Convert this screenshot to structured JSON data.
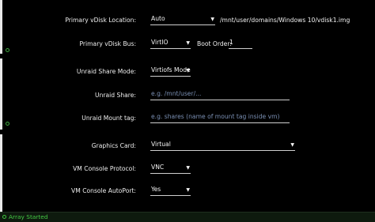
{
  "vdisk": {
    "location_label": "Primary vDisk Location:",
    "location_value": "Auto",
    "location_path": "/mnt/user/domains/Windows 10/vdisk1.img",
    "bus_label": "Primary vDisk Bus:",
    "bus_value": "VirtIO",
    "boot_order_label": "Boot Order:",
    "boot_order_value": "1"
  },
  "share": {
    "mode_label": "Unraid Share Mode:",
    "mode_value": "Virtiofs Mode",
    "share_label": "Unraid Share:",
    "share_placeholder": "e.g. /mnt/user/...",
    "mount_tag_label": "Unraid Mount tag:",
    "mount_tag_placeholder": "e.g. shares (name of mount tag inside vm)"
  },
  "graphics": {
    "card_label": "Graphics Card:",
    "card_value": "Virtual",
    "console_protocol_label": "VM Console Protocol:",
    "console_protocol_value": "VNC",
    "console_autoport_label": "VM Console AutoPort:",
    "console_autoport_value": "Yes"
  },
  "status": {
    "text": "Array Started",
    "color": "#44c944"
  },
  "icons": {
    "section_toggle": "circle-plus-icon",
    "array_status": "status-dot-icon",
    "dropdown": "caret-down-icon"
  }
}
